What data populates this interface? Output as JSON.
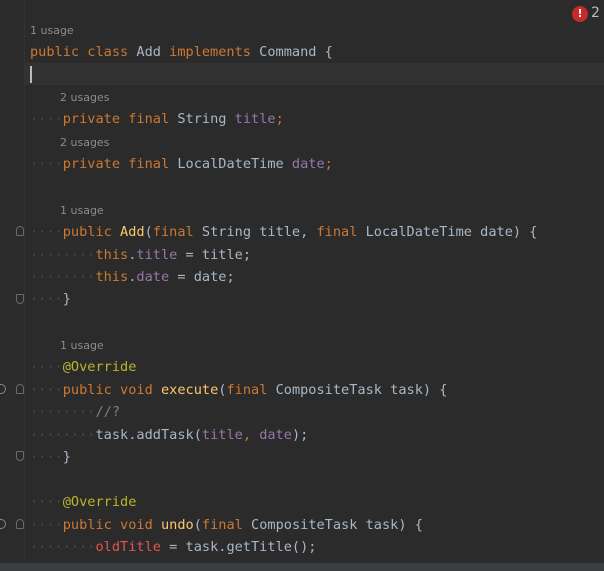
{
  "inspection": {
    "error_badge": "!",
    "error_count": "2"
  },
  "hints": {
    "h1": "1 usage",
    "h2": "2 usages",
    "h3": "2 usages",
    "h4": "1 usage",
    "h5": "1 usage"
  },
  "code": {
    "l1": [
      "public",
      " ",
      "class",
      " Add ",
      "implements",
      " Command {"
    ],
    "l3": [
      "private",
      " ",
      "final",
      " String ",
      "title",
      ";"
    ],
    "l4": [
      "private",
      " ",
      "final",
      " LocalDateTime ",
      "date",
      ";"
    ],
    "l6": [
      "public",
      " ",
      "Add",
      "(",
      "final",
      " String title, ",
      "final",
      " LocalDateTime date) {"
    ],
    "l7": [
      "this",
      ".",
      "title",
      " = title;"
    ],
    "l8": [
      "this",
      ".",
      "date",
      " = date;"
    ],
    "l9": [
      "}"
    ],
    "l11": [
      "@Override"
    ],
    "l12": [
      "public",
      " ",
      "void",
      " ",
      "execute",
      "(",
      "final",
      " CompositeTask task) {"
    ],
    "l13": [
      "//?"
    ],
    "l14": [
      "task.addTask(",
      "title",
      ", ",
      "date",
      ");"
    ],
    "l15": [
      "}"
    ],
    "l17": [
      "@Override"
    ],
    "l18": [
      "public",
      " ",
      "void",
      " ",
      "undo",
      "(",
      "final",
      " CompositeTask task) {"
    ],
    "l19": [
      "oldTitle",
      " = task.getTitle();"
    ]
  },
  "colors": {
    "background": "#2b2b2b",
    "keyword": "#cc7832",
    "field": "#9876aa",
    "method": "#ffc66d",
    "annotation": "#bbb529",
    "error": "#e05555"
  }
}
